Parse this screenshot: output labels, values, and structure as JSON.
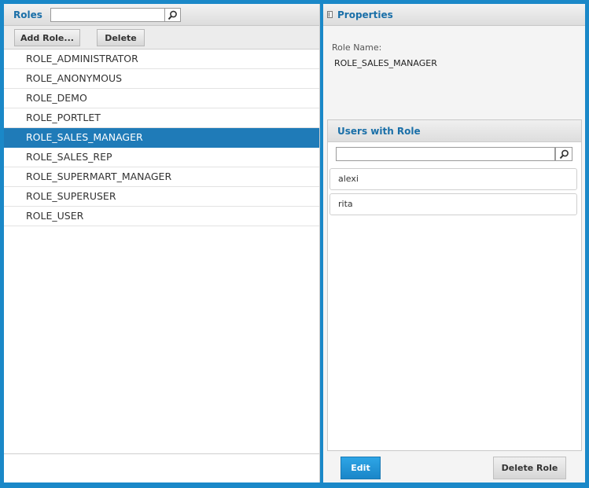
{
  "roles_panel": {
    "title": "Roles",
    "search": {
      "value": "",
      "placeholder": ""
    },
    "toolbar": {
      "add_label": "Add Role...",
      "delete_label": "Delete"
    },
    "roles": [
      {
        "label": "ROLE_ADMINISTRATOR",
        "selected": false
      },
      {
        "label": "ROLE_ANONYMOUS",
        "selected": false
      },
      {
        "label": "ROLE_DEMO",
        "selected": false
      },
      {
        "label": "ROLE_PORTLET",
        "selected": false
      },
      {
        "label": "ROLE_SALES_MANAGER",
        "selected": true
      },
      {
        "label": "ROLE_SALES_REP",
        "selected": false
      },
      {
        "label": "ROLE_SUPERMART_MANAGER",
        "selected": false
      },
      {
        "label": "ROLE_SUPERUSER",
        "selected": false
      },
      {
        "label": "ROLE_USER",
        "selected": false
      }
    ]
  },
  "properties_panel": {
    "title": "Properties",
    "role_name_label": "Role Name:",
    "role_name_value": "ROLE_SALES_MANAGER",
    "users_section": {
      "title": "Users with Role",
      "search": {
        "value": "",
        "placeholder": ""
      },
      "users": [
        "alexi",
        "rita"
      ]
    },
    "edit_label": "Edit",
    "delete_role_label": "Delete Role"
  },
  "colors": {
    "frame": "#1a88c8",
    "header_text": "#1a6fa8",
    "selected_row": "#1f7bb8",
    "edit_button": "#1a86c8"
  },
  "icons": {
    "search": "magnifier-icon",
    "collapse": "collapse-panel-icon"
  }
}
